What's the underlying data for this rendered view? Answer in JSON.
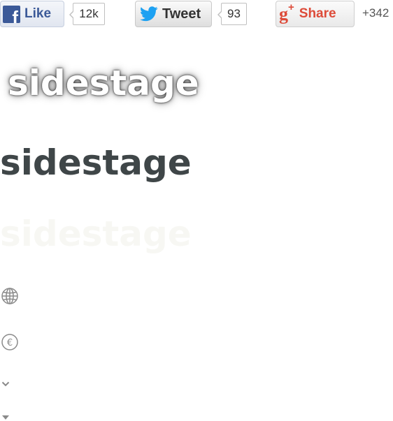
{
  "social": {
    "facebook": {
      "label": "Like",
      "count": "12k",
      "logo_glyph": "f",
      "color": "#3b5998"
    },
    "twitter": {
      "label": "Tweet",
      "count": "93",
      "color": "#1da1f2"
    },
    "google_plus": {
      "label": "Share",
      "count": "+342",
      "logo_glyph": "g",
      "logo_sup": "+",
      "color": "#dd4b39"
    }
  },
  "logos": {
    "glow": "sidestage",
    "dark": "sidestage",
    "faint": "sidestage"
  },
  "icons": {
    "globe": "globe-icon",
    "euro": "euro-icon",
    "chevron": "chevron-down-icon",
    "caret": "caret-down-icon"
  },
  "colors": {
    "logo_dark": "#3f4648",
    "icon_gray": "#8a8a8a"
  }
}
